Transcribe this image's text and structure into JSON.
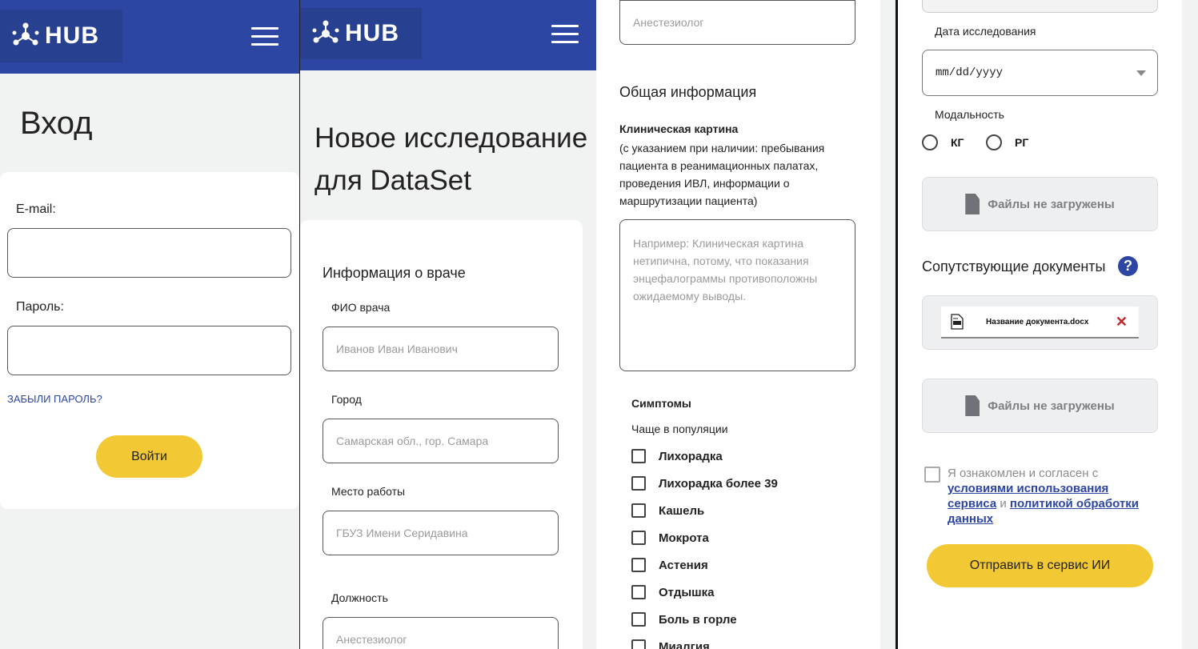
{
  "brand": {
    "name": "HUB",
    "header_color": "#2d46a3",
    "accent": "#f2c935"
  },
  "login": {
    "title": "Вход",
    "email_label": "E-mail:",
    "email_value": "",
    "password_label": "Пароль:",
    "password_value": "",
    "forgot_link": "ЗАБЫЛИ ПАРОЛЬ?",
    "submit_label": "Войти"
  },
  "study": {
    "title_line1": "Новое исследование",
    "title_line2": "для DataSet",
    "doctor_section": "Информация о враче",
    "fio_label": "ФИО врача",
    "fio_placeholder": "Иванов Иван Иванович",
    "city_label": "Город",
    "city_placeholder": "Самарская обл., гор. Самара",
    "work_label": "Место работы",
    "work_placeholder": "ГБУЗ Имени Серидавина",
    "position_label": "Должность",
    "position_placeholder": "Анестезиолог"
  },
  "general": {
    "position_placeholder": "Анестезиолог",
    "section": "Общая информация",
    "clinical_title": "Клиническая картина",
    "clinical_hint": "(с указанием при наличии: пребывания пациента в реанимационных палатах, проведения ИВЛ, информации о маршрутизации пациента)",
    "clinical_placeholder": "Например: Клиническая картина нетипична, потому, что показания энцефалограммы противоположны ожидаемому выводы.",
    "symptoms_title": "Симптомы",
    "symptoms_subtitle": "Чаще в популяции",
    "symptoms": [
      "Лихорадка",
      "Лихорадка более 39",
      "Кашель",
      "Мокрота",
      "Астения",
      "Отдышка",
      "Боль в горле",
      "Миалгия"
    ]
  },
  "upload": {
    "date_label": "Дата исследования",
    "date_placeholder": "mm/dd/yyyy",
    "modality_label": "Модальность",
    "modality_options": [
      "КГ",
      "РГ"
    ],
    "no_files": "Файлы не загружены",
    "docs_title": "Сопутствующие документы",
    "doc_name": "Название документа.docx",
    "no_files_2": "Файлы не загружены",
    "consent_text": "Я ознакомлен и согласен с",
    "terms_link": "условиями использования сервиса",
    "and_text": "и",
    "privacy_link": "политикой обработки данных",
    "submit_label": "Отправить в сервис ИИ"
  }
}
